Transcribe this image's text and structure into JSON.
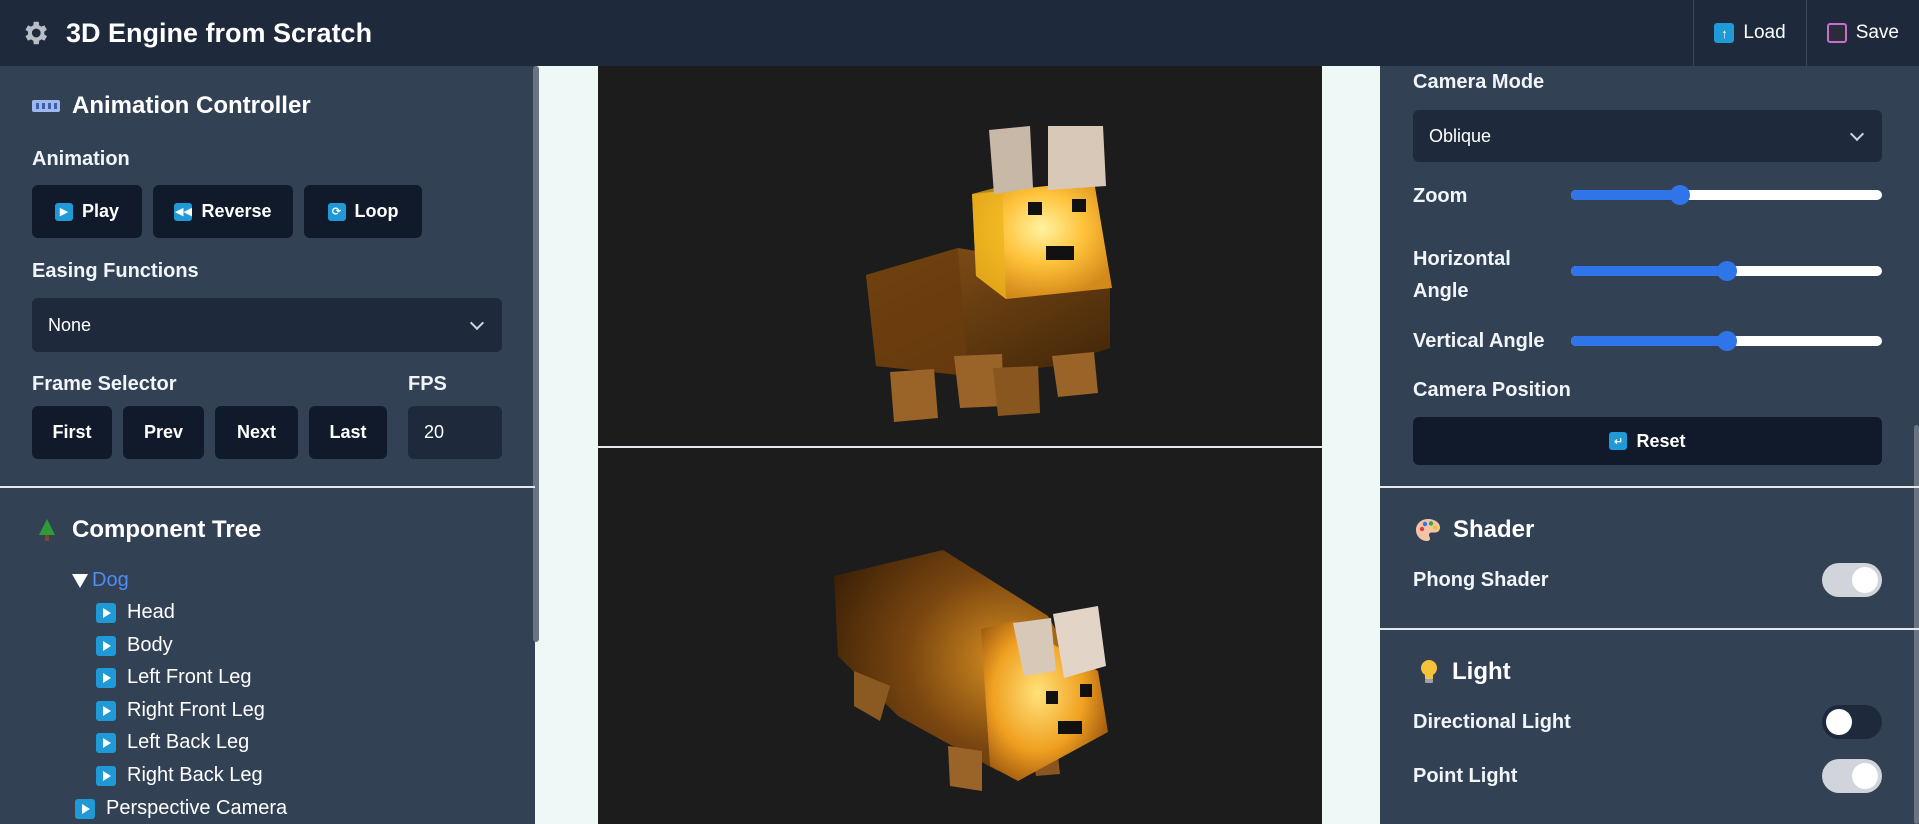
{
  "header": {
    "title": "3D Engine from Scratch",
    "load_label": "Load",
    "save_label": "Save"
  },
  "animation_controller": {
    "title": "Animation Controller",
    "animation_label": "Animation",
    "play_label": "Play",
    "reverse_label": "Reverse",
    "loop_label": "Loop",
    "easing_label": "Easing Functions",
    "easing_value": "None",
    "frame_selector_label": "Frame Selector",
    "first_label": "First",
    "prev_label": "Prev",
    "next_label": "Next",
    "last_label": "Last",
    "fps_label": "FPS",
    "fps_value": "20"
  },
  "component_tree": {
    "title": "Component Tree",
    "root": "Dog",
    "children": [
      "Head",
      "Body",
      "Left Front Leg",
      "Right Front Leg",
      "Left Back Leg",
      "Right Back Leg"
    ],
    "siblings": [
      "Perspective Camera"
    ]
  },
  "camera": {
    "mode_label": "Camera Mode",
    "mode_value": "Oblique",
    "zoom_label": "Zoom",
    "zoom_value": 0.35,
    "horizontal_label": "Horizontal Angle",
    "horizontal_value": 0.5,
    "vertical_label": "Vertical Angle",
    "vertical_value": 0.5,
    "position_label": "Camera Position",
    "reset_label": "Reset"
  },
  "shader": {
    "title": "Shader",
    "phong_label": "Phong Shader",
    "phong_on": true
  },
  "light": {
    "title": "Light",
    "directional_label": "Directional Light",
    "directional_on": false,
    "point_label": "Point Light",
    "point_on": true
  },
  "colors": {
    "accent": "#2f74e8",
    "icon_blue": "#1f9ad6",
    "panel": "#334155",
    "header": "#1e293b",
    "link": "#4c8ff0"
  },
  "icons": {
    "header": "gear-icon",
    "animation": "film-icon",
    "tree": "tree-icon",
    "shader": "palette-icon",
    "light": "bulb-icon"
  }
}
